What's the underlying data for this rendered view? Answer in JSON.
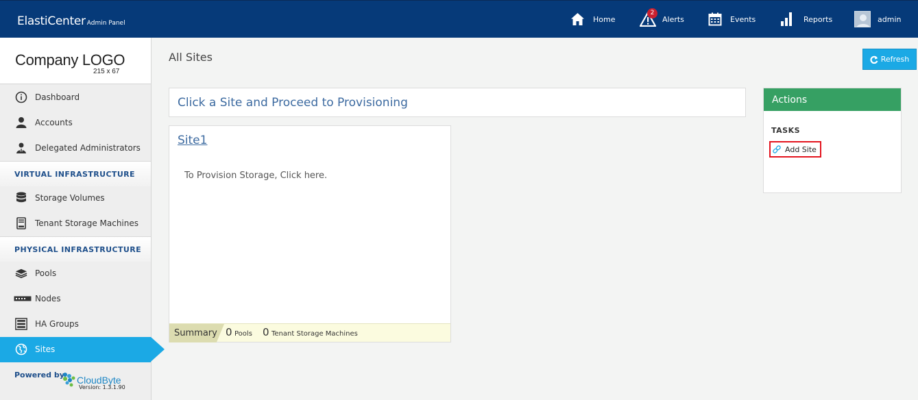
{
  "header": {
    "brand": "ElastiCenter",
    "brand_sub": "Admin Panel",
    "nav": {
      "home": "Home",
      "alerts": "Alerts",
      "alerts_count": "2",
      "events": "Events",
      "reports": "Reports",
      "user": "admin"
    }
  },
  "sidebar": {
    "logo_text": "Company LOGO",
    "logo_dims": "215 x 67",
    "items": [
      {
        "label": "Dashboard",
        "icon": "info-icon"
      },
      {
        "label": "Accounts",
        "icon": "user-icon"
      },
      {
        "label": "Delegated Administrators",
        "icon": "admin-icon"
      }
    ],
    "section_virtual": "VIRTUAL INFRASTRUCTURE",
    "virtual_items": [
      {
        "label": "Storage Volumes",
        "icon": "database-icon"
      },
      {
        "label": "Tenant Storage Machines",
        "icon": "server-icon"
      }
    ],
    "section_physical": "PHYSICAL INFRASTRUCTURE",
    "physical_items": [
      {
        "label": "Pools",
        "icon": "layers-icon"
      },
      {
        "label": "Nodes",
        "icon": "node-icon"
      },
      {
        "label": "HA Groups",
        "icon": "rack-icon"
      },
      {
        "label": "Sites",
        "icon": "globe-icon",
        "active": true
      }
    ],
    "powered_by": "Powered by",
    "vendor_name": "CloudByte",
    "version": "Version: 1.3.1.90"
  },
  "main": {
    "title": "All Sites",
    "refresh_label": "Refresh",
    "banner": "Click a Site and Proceed to Provisioning",
    "site": {
      "name": "Site1",
      "provision_text": "To Provision Storage, Click here.",
      "summary_label": "Summary",
      "pools_count": "0",
      "pools_label": "Pools",
      "tsm_count": "0",
      "tsm_label": "Tenant Storage Machines"
    }
  },
  "actions": {
    "title": "Actions",
    "tasks_label": "TASKS",
    "add_site": "Add Site"
  },
  "colors": {
    "topbar": "#063a79",
    "accent": "#1ba9e5",
    "actions_header": "#36a063",
    "highlight": "#e3141e"
  }
}
